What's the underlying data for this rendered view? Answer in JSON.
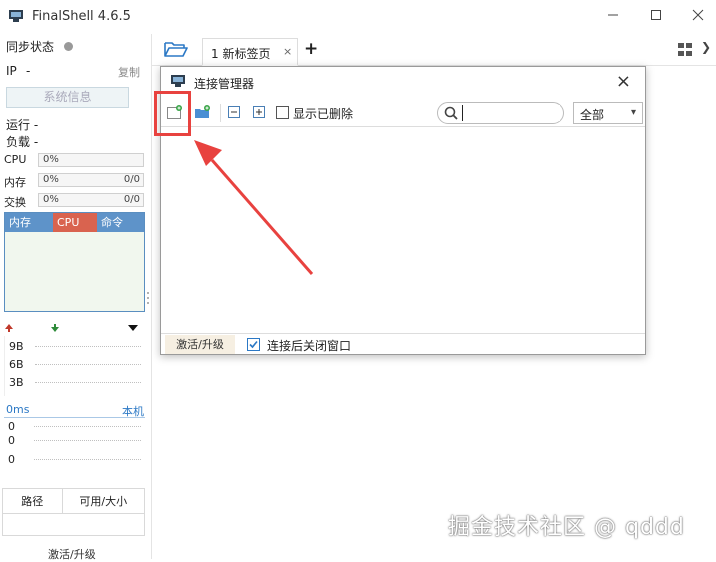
{
  "window": {
    "title": "FinalShell 4.6.5",
    "min_icon": "minimize-icon",
    "max_icon": "maximize-icon",
    "close_icon": "close-icon"
  },
  "sidebar": {
    "sync_label": "同步状态",
    "ip_label": "IP",
    "ip_value": "-",
    "copy_label": "复制",
    "sysinfo_button": "系统信息",
    "running_label": "运行 -",
    "load_label": "负载 -",
    "meters": [
      {
        "label": "CPU",
        "value": "0%",
        "right": ""
      },
      {
        "label": "内存",
        "value": "0%",
        "right": "0/0"
      },
      {
        "label": "交换",
        "value": "0%",
        "right": "0/0"
      }
    ],
    "proc_headers": [
      "内存",
      "CPU",
      "命令"
    ],
    "proc_colors": [
      "#5e93c9",
      "#d9634f",
      "#5e93c9"
    ],
    "net_y_labels": [
      "9B",
      "6B",
      "3B"
    ],
    "latency_label": "0ms",
    "machine_label": "本机",
    "latency_y_labels": [
      "0",
      "0",
      "0"
    ],
    "disk_headers": [
      "路径",
      "可用/大小"
    ],
    "activate": "激活/升级"
  },
  "tabs": {
    "items": [
      {
        "label": "1 新标签页"
      }
    ],
    "close_glyph": "×",
    "plus_glyph": "+",
    "chevron_glyph": "❯"
  },
  "dialog": {
    "title": "连接管理器",
    "close_glyph": "×",
    "show_deleted": "显示已删除",
    "search_placeholder": "",
    "filter_value": "全部",
    "filter_caret": "▾",
    "footer_activate": "激活/升级",
    "close_after_connect": "连接后关闭窗口"
  },
  "watermark": "掘金技术社区 @ qddd",
  "colors": {
    "accent_blue": "#2b78c5",
    "highlight_red": "#e8423f"
  }
}
